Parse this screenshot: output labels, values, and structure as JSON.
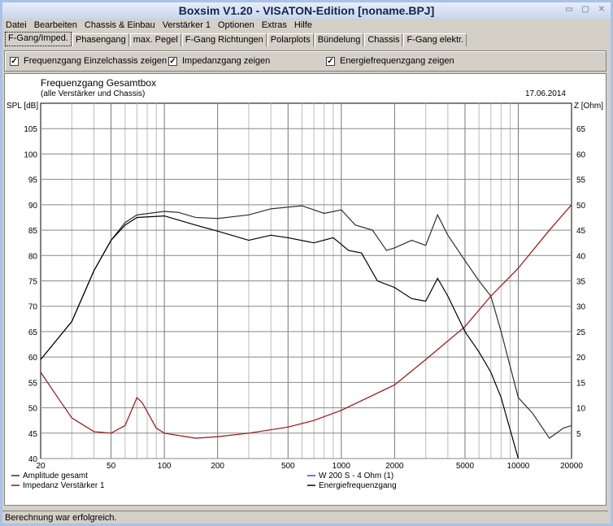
{
  "window": {
    "title": "Boxsim V1.20 - VISATON-Edition [noname.BPJ]"
  },
  "menu": [
    "Datei",
    "Bearbeiten",
    "Chassis & Einbau",
    "Verstärker 1",
    "Optionen",
    "Extras",
    "Hilfe"
  ],
  "tabs": [
    "F-Gang/Imped.",
    "Phasengang",
    "max. Pegel",
    "F-Gang Richtungen",
    "Polarplots",
    "Bündelung",
    "Chassis",
    "F-Gang elektr."
  ],
  "options": [
    {
      "label": "Frequenzgang Einzelchassis zeigen",
      "checked": true
    },
    {
      "label": "Impedanzgang zeigen",
      "checked": true
    },
    {
      "label": "Energiefrequenzgang zeigen",
      "checked": true
    }
  ],
  "status": "Berechnung war erfolgreich.",
  "chart_data": {
    "type": "line",
    "title": "Frequenzgang Gesamtbox",
    "subtitle": "(alle Verstärker und Chassis)",
    "date": "17.06.2014",
    "ylabel": "SPL [dB]",
    "y2label": "Z [Ohm]",
    "xlim": [
      20,
      20000
    ],
    "ylim": [
      40,
      110
    ],
    "y2lim": [
      0,
      70
    ],
    "xticks": [
      20,
      50,
      100,
      200,
      500,
      1000,
      2000,
      5000,
      10000,
      20000
    ],
    "yticks": [
      40,
      45,
      50,
      55,
      60,
      65,
      70,
      75,
      80,
      85,
      90,
      95,
      100,
      105
    ],
    "y2ticks": [
      5,
      10,
      15,
      20,
      25,
      30,
      35,
      40,
      45,
      50,
      55,
      60,
      65
    ],
    "colors": {
      "amplitude": "#303030",
      "impedance": "#a01010",
      "chassis": "#4040ff",
      "energy": "#000000"
    },
    "series": [
      {
        "name": "Amplitude gesamt",
        "axis": "left",
        "color": "#303030",
        "points": [
          [
            20,
            59.5
          ],
          [
            30,
            67
          ],
          [
            40,
            77
          ],
          [
            50,
            83
          ],
          [
            60,
            86.5
          ],
          [
            70,
            88
          ],
          [
            100,
            88.7
          ],
          [
            120,
            88.5
          ],
          [
            150,
            87.5
          ],
          [
            200,
            87.3
          ],
          [
            300,
            88
          ],
          [
            400,
            89.2
          ],
          [
            600,
            89.8
          ],
          [
            800,
            88.3
          ],
          [
            1000,
            89
          ],
          [
            1200,
            86
          ],
          [
            1500,
            85
          ],
          [
            1800,
            81
          ],
          [
            2000,
            81.5
          ],
          [
            2500,
            83
          ],
          [
            3000,
            82
          ],
          [
            3500,
            88
          ],
          [
            4000,
            84
          ],
          [
            5000,
            79
          ],
          [
            6000,
            75
          ],
          [
            7000,
            72
          ],
          [
            8000,
            65
          ],
          [
            10000,
            52
          ],
          [
            12000,
            49
          ],
          [
            15000,
            44
          ],
          [
            18000,
            46
          ],
          [
            20000,
            46.5
          ]
        ]
      },
      {
        "name": "Impedanz Verstärker 1",
        "axis": "right",
        "color": "#a01010",
        "points": [
          [
            20,
            17
          ],
          [
            25,
            12
          ],
          [
            30,
            8
          ],
          [
            40,
            5.3
          ],
          [
            50,
            5
          ],
          [
            60,
            6.5
          ],
          [
            70,
            12
          ],
          [
            75,
            11
          ],
          [
            90,
            6
          ],
          [
            100,
            5
          ],
          [
            150,
            4
          ],
          [
            200,
            4.3
          ],
          [
            300,
            5
          ],
          [
            500,
            6.2
          ],
          [
            700,
            7.5
          ],
          [
            1000,
            9.5
          ],
          [
            2000,
            14.5
          ],
          [
            3000,
            19.5
          ],
          [
            5000,
            26
          ],
          [
            7000,
            32
          ],
          [
            10000,
            37.5
          ],
          [
            15000,
            45
          ],
          [
            20000,
            50
          ]
        ]
      },
      {
        "name": "W 200 S - 4 Ohm (1)",
        "axis": "left",
        "color": "#4040ff",
        "points": []
      },
      {
        "name": "Energiefrequenzgang",
        "axis": "left",
        "color": "#000000",
        "points": [
          [
            20,
            59.5
          ],
          [
            30,
            67
          ],
          [
            40,
            77
          ],
          [
            50,
            83
          ],
          [
            60,
            86
          ],
          [
            70,
            87.5
          ],
          [
            100,
            87.8
          ],
          [
            150,
            86
          ],
          [
            200,
            84.8
          ],
          [
            300,
            83
          ],
          [
            400,
            84
          ],
          [
            500,
            83.5
          ],
          [
            700,
            82.5
          ],
          [
            900,
            83.5
          ],
          [
            1100,
            81
          ],
          [
            1300,
            80.5
          ],
          [
            1600,
            75
          ],
          [
            2000,
            73.7
          ],
          [
            2500,
            71.5
          ],
          [
            3000,
            71
          ],
          [
            3500,
            75.5
          ],
          [
            4000,
            72
          ],
          [
            5000,
            65
          ],
          [
            6000,
            61
          ],
          [
            7000,
            57
          ],
          [
            8000,
            52
          ],
          [
            10000,
            40
          ]
        ]
      }
    ]
  }
}
